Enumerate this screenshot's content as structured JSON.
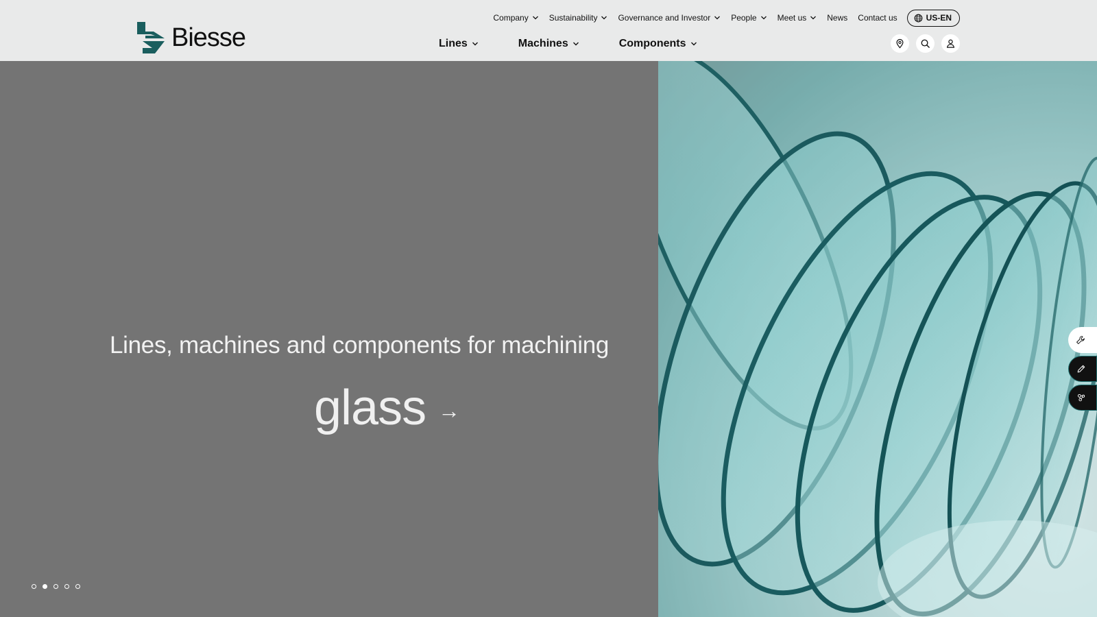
{
  "brand": {
    "name": "Biesse",
    "accent": "#1a5e5e"
  },
  "topnav": {
    "items": [
      {
        "label": "Company",
        "dropdown": true
      },
      {
        "label": "Sustainability",
        "dropdown": true
      },
      {
        "label": "Governance and Investor",
        "dropdown": true
      },
      {
        "label": "People",
        "dropdown": true
      },
      {
        "label": "Meet us",
        "dropdown": true
      },
      {
        "label": "News",
        "dropdown": false
      },
      {
        "label": "Contact us",
        "dropdown": false
      }
    ],
    "language": "US-EN"
  },
  "mainnav": {
    "items": [
      {
        "label": "Lines"
      },
      {
        "label": "Machines"
      },
      {
        "label": "Components"
      }
    ]
  },
  "utility": {
    "icons": [
      "location-pin-icon",
      "search-icon",
      "user-icon"
    ]
  },
  "hero": {
    "headline": "Lines, machines and components for machining",
    "word": "glass",
    "arrow": "→",
    "slides_total": 5,
    "active_slide": 2,
    "left_bg": "#747474"
  },
  "side_tools": {
    "icons": [
      "wrench-icon",
      "pencil-icon",
      "network-icon"
    ]
  }
}
